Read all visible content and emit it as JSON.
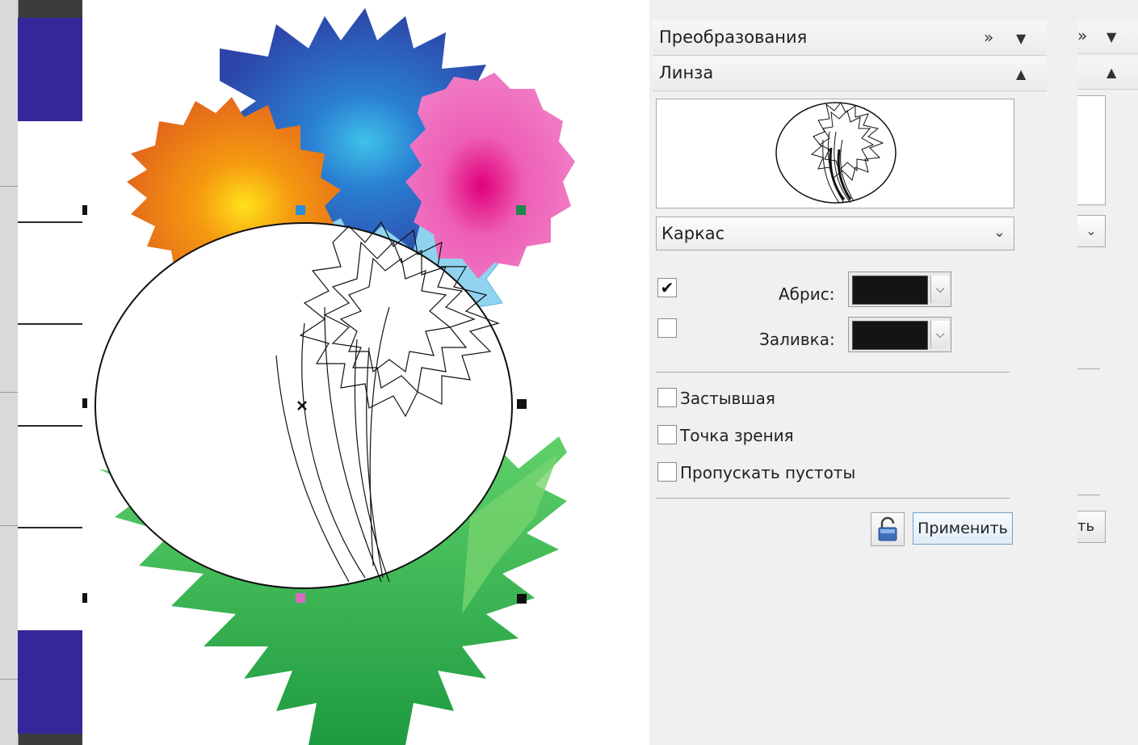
{
  "docker": {
    "transform_header": "Преобразования",
    "lens_header": "Линза",
    "lens_type": "Каркас",
    "outline_label": "Абрис:",
    "outline_checked": true,
    "outline_color": "#141414",
    "fill_label": "Заливка:",
    "fill_checked": false,
    "fill_color": "#141414",
    "frozen_label": "Застывшая",
    "viewpoint_label": "Точка зрения",
    "remove_face_label": "Пропускать пустоты",
    "apply_label": "Применить",
    "icons": [
      "double-chevron-right-icon",
      "triangle-down-icon",
      "triangle-up-icon",
      "chevron-down-icon",
      "lock-icon"
    ]
  },
  "docker2": {
    "apply_partial": "ть"
  },
  "palette": {
    "colors": [
      "#35279a",
      "#ffffff",
      "#35279a"
    ]
  }
}
